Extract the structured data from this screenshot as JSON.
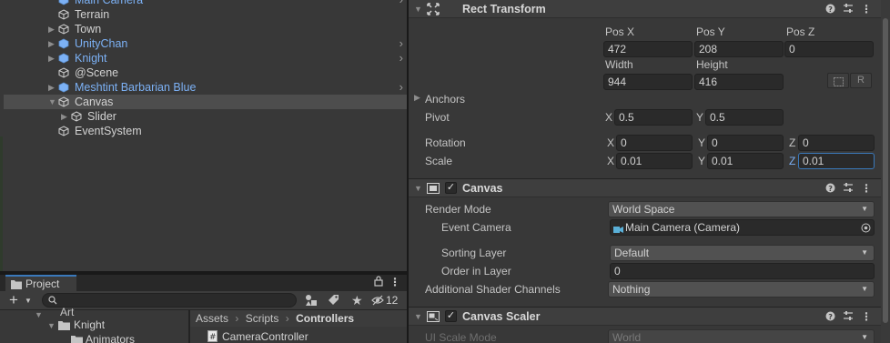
{
  "hierarchy": {
    "items": [
      {
        "label": "Main Camera"
      },
      {
        "label": "Terrain"
      },
      {
        "label": "Town"
      },
      {
        "label": "UnityChan"
      },
      {
        "label": "Knight"
      },
      {
        "label": "@Scene"
      },
      {
        "label": "Meshtint Barbarian Blue"
      },
      {
        "label": "Canvas"
      },
      {
        "label": "Slider"
      },
      {
        "label": "EventSystem"
      }
    ]
  },
  "project": {
    "tab_label": "Project",
    "hidden_count": "12",
    "tree": [
      {
        "label": "Art"
      },
      {
        "label": "Knight"
      },
      {
        "label": "Animators"
      }
    ],
    "breadcrumb": [
      "Assets",
      "Scripts",
      "Controllers"
    ],
    "files": [
      {
        "label": "CameraController"
      }
    ]
  },
  "inspector": {
    "rect_transform": {
      "title": "Rect Transform",
      "pos_x_label": "Pos X",
      "pos_y_label": "Pos Y",
      "pos_z_label": "Pos Z",
      "pos_x": "472",
      "pos_y": "208",
      "pos_z": "0",
      "width_label": "Width",
      "height_label": "Height",
      "width": "944",
      "height": "416",
      "anchors_label": "Anchors",
      "pivot_label": "Pivot",
      "pivot_x": "0.5",
      "pivot_y": "0.5",
      "rotation_label": "Rotation",
      "rot_x": "0",
      "rot_y": "0",
      "rot_z": "0",
      "scale_label": "Scale",
      "scale_x": "0.01",
      "scale_y": "0.01",
      "scale_z": "0.01",
      "x": "X",
      "y": "Y",
      "z": "Z",
      "raw_button": "R"
    },
    "canvas": {
      "title": "Canvas",
      "render_mode_label": "Render Mode",
      "render_mode": "World Space",
      "event_camera_label": "Event Camera",
      "event_camera": "Main Camera (Camera)",
      "sorting_layer_label": "Sorting Layer",
      "sorting_layer": "Default",
      "order_label": "Order in Layer",
      "order": "0",
      "shader_label": "Additional Shader Channels",
      "shader": "Nothing"
    },
    "canvas_scaler": {
      "title": "Canvas Scaler",
      "scale_mode_label": "UI Scale Mode",
      "scale_mode": "World"
    }
  },
  "colors": {
    "prefab": "#7cb1f5",
    "selection": "#4d4d4d",
    "accent": "#3a79bb",
    "panel": "#383838"
  }
}
